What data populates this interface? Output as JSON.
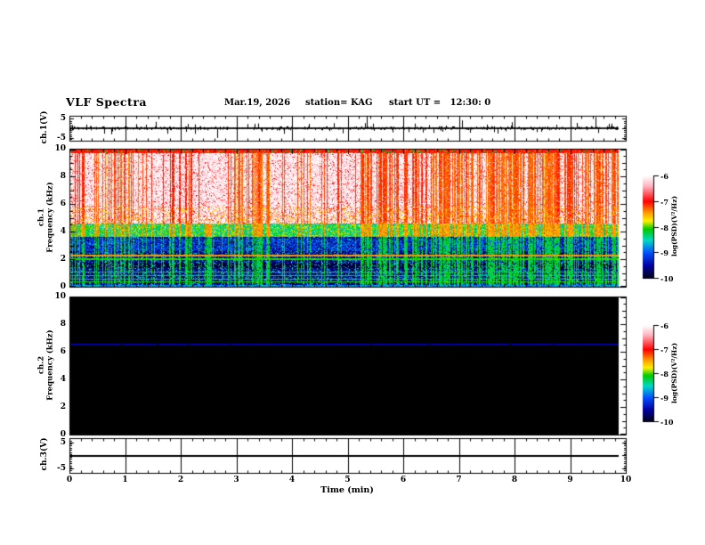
{
  "header": {
    "title": "VLF Spectra",
    "date": "Mar.19, 2026",
    "station": "station= KAG",
    "start_ut": "start UT =   12:30: 0"
  },
  "time_axis": {
    "label": "Time (min)",
    "tick_labels": [
      "0",
      "1",
      "2",
      "3",
      "4",
      "5",
      "6",
      "7",
      "8",
      "9",
      "10"
    ]
  },
  "panels": {
    "ch1v": {
      "axis_label": "ch.1(V)",
      "tick_labels": [
        "5",
        "-5"
      ]
    },
    "ch1f": {
      "axis_label_line1": "ch.1",
      "axis_label_line2": "Frequency (kHz)",
      "tick_labels": [
        "10",
        "8",
        "6",
        "4",
        "2",
        "0"
      ]
    },
    "ch2f": {
      "axis_label_line1": "ch.2",
      "axis_label_line2": "Frequency (kHz)",
      "tick_labels": [
        "10",
        "8",
        "6",
        "4",
        "2",
        "0"
      ]
    },
    "ch3v": {
      "axis_label": "ch.3(V)",
      "tick_labels": [
        "5",
        "-5"
      ]
    }
  },
  "colorbar": {
    "tick_labels": [
      "-6",
      "-7",
      "-8",
      "-9",
      "-10"
    ],
    "unit_label": "log(PSD)(V²/Hz)",
    "stops": [
      {
        "u": 0.0,
        "c": "#ffffff"
      },
      {
        "u": 0.1,
        "c": "#ffb4c0"
      },
      {
        "u": 0.25,
        "c": "#ff0000"
      },
      {
        "u": 0.36,
        "c": "#ff9c00"
      },
      {
        "u": 0.44,
        "c": "#fff000"
      },
      {
        "u": 0.52,
        "c": "#00cc00"
      },
      {
        "u": 0.63,
        "c": "#00d8c8"
      },
      {
        "u": 0.75,
        "c": "#0050ff"
      },
      {
        "u": 0.88,
        "c": "#0000a0"
      },
      {
        "u": 1.0,
        "c": "#000014"
      }
    ]
  },
  "chart_data": {
    "type": "heatmap",
    "title": "VLF Spectra",
    "station": "KAG",
    "date": "Mar.19, 2026",
    "start_ut": "12:30: 0",
    "x": {
      "label": "Time (min)",
      "range": [
        0,
        10
      ],
      "major_tick_step": 1,
      "minor_tick_step": 0.2
    },
    "panels": [
      {
        "name": "ch.1(V)",
        "type": "line",
        "yrange": [
          -5,
          5
        ],
        "description": "broadband noise of ~±0.7 V about 0 V with many impulsive sferic spikes",
        "noise_v": 0.7,
        "spikes": {
          "times_min": [
            0.3,
            0.75,
            1.2,
            1.55,
            2.1,
            2.65,
            3.0,
            3.45,
            3.85,
            4.3,
            4.75,
            5.35,
            5.8,
            6.2,
            6.7,
            7.05,
            7.5,
            7.95,
            8.4,
            8.75,
            9.0,
            9.45,
            9.75
          ],
          "amps_v": [
            1.6,
            -2.6,
            1.8,
            2.8,
            -1.6,
            -4.2,
            1.7,
            -1.5,
            -2.4,
            1.9,
            2.2,
            5.0,
            -1.8,
            2.0,
            -1.5,
            3.4,
            1.6,
            2.6,
            -1.7,
            1.5,
            -4.6,
            4.8,
            2.0
          ]
        }
      },
      {
        "name": "ch.1 Frequency (kHz)",
        "type": "heatmap",
        "yrange": [
          0,
          10
        ],
        "zrange_log_psd": [
          -10,
          -6
        ],
        "description": "active channel: PSD near -6 (white) above ~4.6 kHz crossed by dense vertical red sferic streaks; -8..-10 (green/blue/black) below 4 kHz with narrow horizontal emission lines",
        "streak_density": 0.45,
        "top_band_khz": [
          9.68,
          10
        ],
        "white_region_khz": [
          4.6,
          9.68
        ],
        "transition_khz": [
          3.6,
          4.6
        ],
        "green_lines_khz": [
          0.35,
          0.55,
          0.8,
          1.05,
          2.0
        ],
        "orange_line_khz": 2.25,
        "dark_bands_khz": [
          [
            1.35,
            1.75
          ],
          [
            0.05,
            0.18
          ]
        ],
        "cyan_band_khz": [
          2.6,
          3.5
        ]
      },
      {
        "name": "ch.2 Frequency (kHz)",
        "type": "heatmap",
        "yrange": [
          0,
          10
        ],
        "zrange_log_psd": [
          -10,
          -6
        ],
        "description": "quiet channel: uniform black background (<= -10) with a single narrow blue carrier line",
        "carrier_line_khz": 6.6
      },
      {
        "name": "ch.3(V)",
        "type": "line",
        "yrange": [
          -5,
          5
        ],
        "description": "constant flat trace near 0 V",
        "value_v": 0
      }
    ],
    "colorbar": {
      "range_log_psd": [
        -6,
        -10
      ],
      "ticks": [
        -6,
        -7,
        -8,
        -9,
        -10
      ],
      "label": "log(PSD)(V²/Hz)"
    }
  }
}
